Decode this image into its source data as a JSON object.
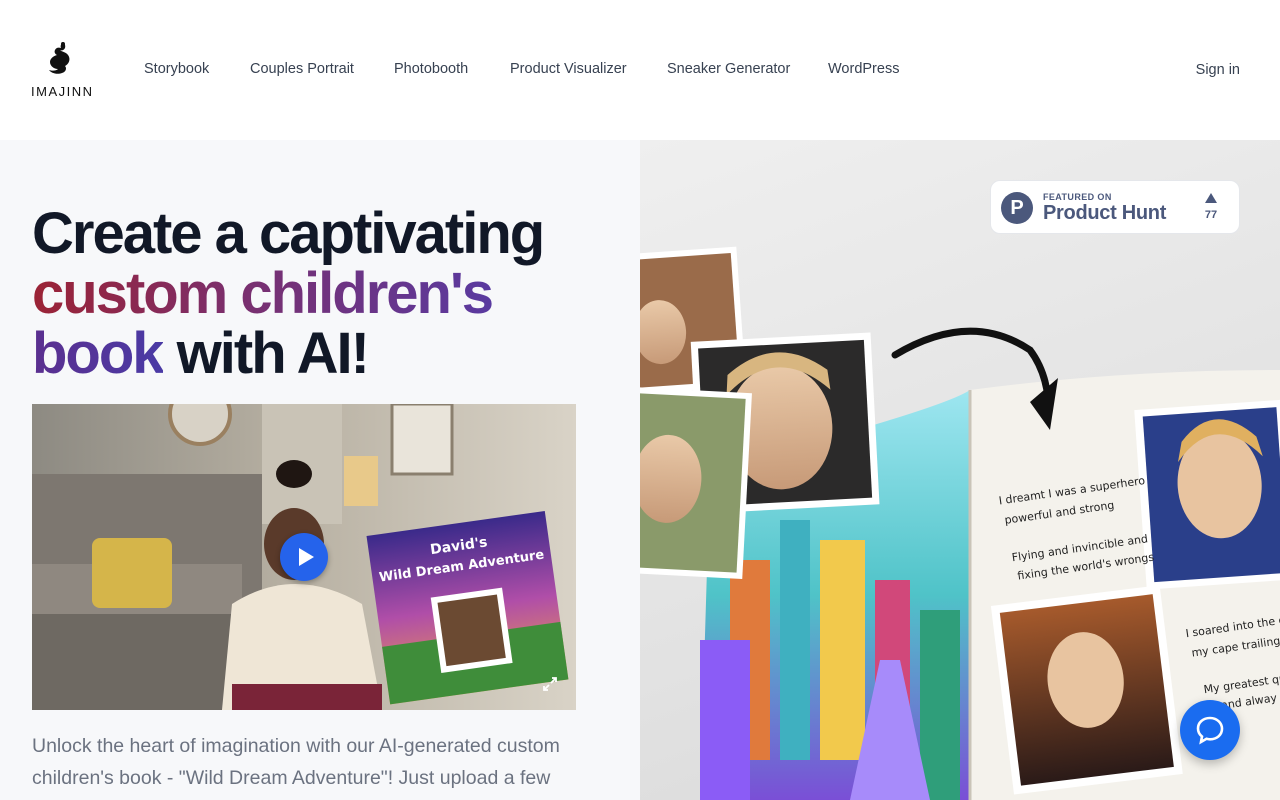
{
  "header": {
    "logo_text": "IMAJINN",
    "nav": [
      {
        "label": "Storybook"
      },
      {
        "label": "Couples Portrait"
      },
      {
        "label": "Photobooth"
      },
      {
        "label": "Product Visualizer"
      },
      {
        "label": "Sneaker Generator"
      },
      {
        "label": "WordPress"
      }
    ],
    "sign_in": "Sign in"
  },
  "hero": {
    "headline_1": "Create a captivating",
    "headline_2": "custom children's",
    "headline_3a": "book",
    "headline_3b": " with AI!",
    "video": {
      "book_title_1": "David's",
      "book_title_2": "Wild Dream Adventure"
    },
    "description": "Unlock the heart of imagination with our AI-generated custom children's book - \"Wild Dream Adventure\"! Just upload a few"
  },
  "showcase": {
    "book_text": [
      "I dreamt I was a superhero",
      "powerful and strong",
      "Flying and invincible and",
      "fixing the world's wrongs",
      "I soared into the c",
      "my cape trailing b",
      "My greatest que",
      "and alway"
    ]
  },
  "product_hunt": {
    "featured": "FEATURED ON",
    "name": "Product Hunt",
    "votes": "77"
  },
  "colors": {
    "accent": "#2563eb",
    "chat": "#1a6cf0",
    "product_hunt": "#4b587c"
  }
}
